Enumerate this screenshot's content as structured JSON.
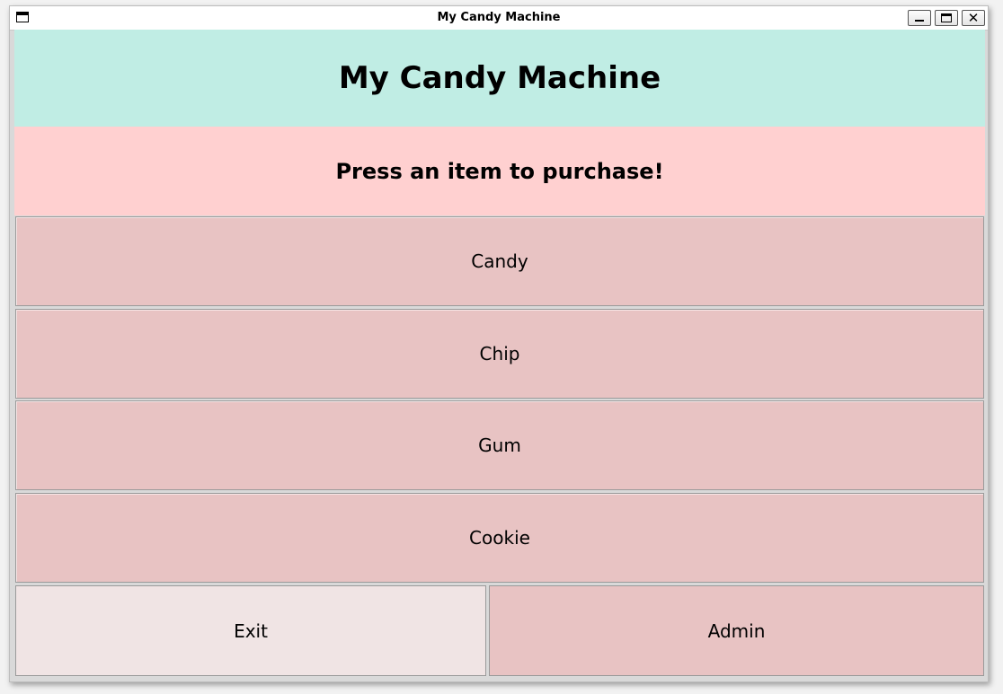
{
  "window": {
    "title": "My Candy Machine",
    "controls": {
      "minimize": "minimize-icon",
      "maximize": "maximize-icon",
      "close": "close-icon"
    }
  },
  "header": {
    "title": "My Candy Machine",
    "background": "#c0ede4"
  },
  "prompt": {
    "text": "Press an item to purchase!",
    "background": "#ffd0d0"
  },
  "items": [
    {
      "label": "Candy"
    },
    {
      "label": "Chip"
    },
    {
      "label": "Gum"
    },
    {
      "label": "Cookie"
    }
  ],
  "footer": {
    "exit_label": "Exit",
    "admin_label": "Admin"
  },
  "colors": {
    "item_button": "#e8c3c3",
    "exit_button": "#f0e4e4"
  }
}
